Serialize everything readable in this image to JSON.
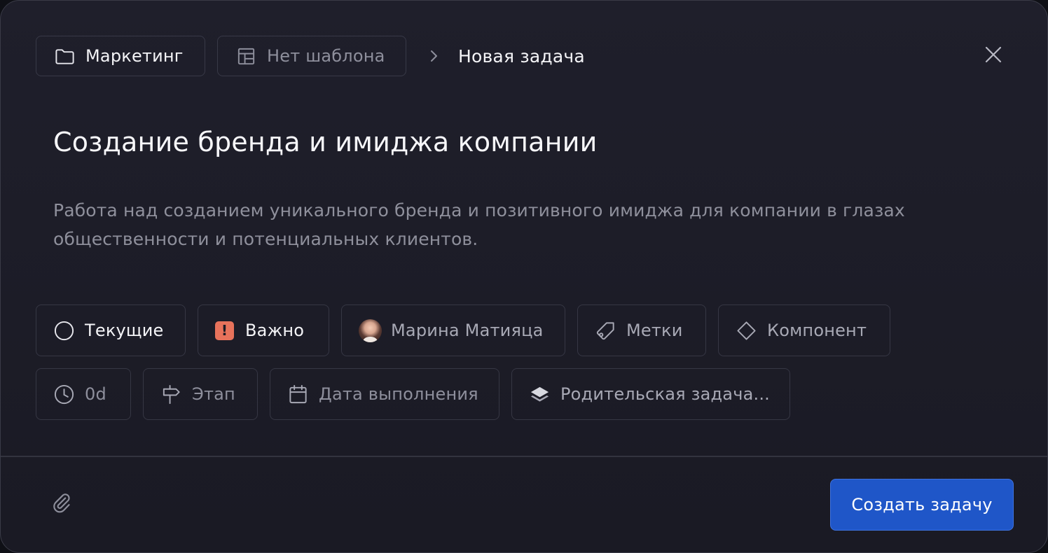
{
  "header": {
    "project": {
      "label": "Маркетинг",
      "icon": "folder-icon"
    },
    "template": {
      "label": "Нет шаблона",
      "icon": "layout-template-icon"
    },
    "separator_icon": "chevron-right-icon",
    "current": "Новая задача",
    "close_icon": "close-icon"
  },
  "task": {
    "title": "Создание бренда и имиджа компании",
    "description": "Работа над созданием уникального бренда и позитивного имиджа для компании в глазах общественности и потенциальных клиентов."
  },
  "properties": {
    "status": {
      "label": "Текущие",
      "icon": "circle-status-icon"
    },
    "priority": {
      "label": "Важно",
      "icon": "exclamation-badge-icon",
      "color": "#e7725b"
    },
    "assignee": {
      "label": "Марина Матияца",
      "icon": "avatar"
    },
    "labels": {
      "label": "Метки",
      "icon": "tag-icon"
    },
    "component": {
      "label": "Компонент",
      "icon": "diamond-icon"
    },
    "estimate": {
      "label": "0d",
      "icon": "clock-icon"
    },
    "stage": {
      "label": "Этап",
      "icon": "signpost-icon"
    },
    "due_date": {
      "label": "Дата выполнения",
      "icon": "calendar-icon"
    },
    "parent": {
      "label": "Родительская задача...",
      "icon": "layers-icon"
    }
  },
  "footer": {
    "attach_icon": "paperclip-icon",
    "submit_label": "Создать задачу"
  },
  "colors": {
    "background": "#1c1c27",
    "border": "#363744",
    "text_primary": "#f4f4f7",
    "text_secondary": "#8e8f9c",
    "accent": "#1f56c8",
    "priority": "#e7725b"
  }
}
